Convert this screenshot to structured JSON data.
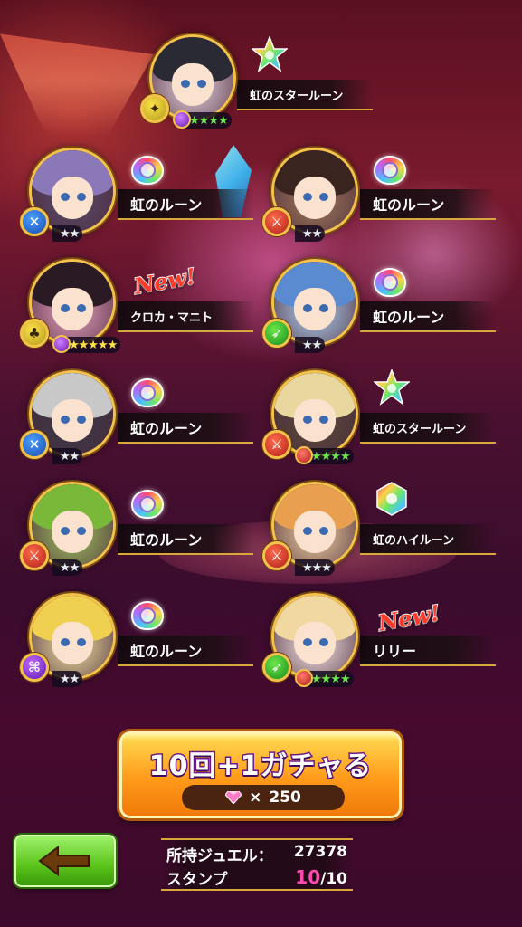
{
  "results": [
    {
      "id": "r1",
      "name": "虹のスタールーン",
      "type": "star",
      "weapon": "yellow",
      "weapon_glyph": "✦",
      "stars": "★★★★",
      "star_color": "green",
      "gem": "purple",
      "new": "",
      "colors": {
        "hair": "#2a2a34",
        "bg": "#ead4e0"
      }
    },
    {
      "id": "r2",
      "name": "虹のルーン",
      "type": "rune",
      "weapon": "blue",
      "weapon_glyph": "✕",
      "stars": "★★",
      "star_color": "white",
      "gem": "",
      "new": "",
      "colors": {
        "hair": "#8a78b8",
        "bg": "#5a4a6a"
      }
    },
    {
      "id": "r3",
      "name": "虹のルーン",
      "type": "rune",
      "weapon": "red",
      "weapon_glyph": "⚔",
      "stars": "★★",
      "star_color": "white",
      "gem": "",
      "new": "",
      "colors": {
        "hair": "#3a2420",
        "bg": "#a07a5a"
      }
    },
    {
      "id": "r4",
      "name": "クロカ・マニト",
      "type": "none",
      "weapon": "yellow",
      "weapon_glyph": "♣",
      "stars": "★★★★★",
      "star_color": "yellow",
      "gem": "purple",
      "new": "New!",
      "colors": {
        "hair": "#2a1a24",
        "bg": "#e8a0c0"
      }
    },
    {
      "id": "r5",
      "name": "虹のルーン",
      "type": "rune",
      "weapon": "green",
      "weapon_glyph": "➶",
      "stars": "★★",
      "star_color": "white",
      "gem": "",
      "new": "",
      "colors": {
        "hair": "#5a8ad0",
        "bg": "#b0d0f0"
      }
    },
    {
      "id": "r6",
      "name": "虹のルーン",
      "type": "rune",
      "weapon": "blue",
      "weapon_glyph": "✕",
      "stars": "★★",
      "star_color": "white",
      "gem": "",
      "new": "",
      "colors": {
        "hair": "#c8c8c8",
        "bg": "#3a3a48"
      }
    },
    {
      "id": "r7",
      "name": "虹のスタールーン",
      "type": "star",
      "weapon": "red",
      "weapon_glyph": "⚔",
      "stars": "★★★★",
      "star_color": "green",
      "gem": "red",
      "new": "",
      "colors": {
        "hair": "#e8d8a0",
        "bg": "#5a4a3a"
      }
    },
    {
      "id": "r8",
      "name": "虹のルーン",
      "type": "rune",
      "weapon": "red",
      "weapon_glyph": "⚔",
      "stars": "★★",
      "star_color": "white",
      "gem": "",
      "new": "",
      "colors": {
        "hair": "#7ab83a",
        "bg": "#a0c060"
      }
    },
    {
      "id": "r9",
      "name": "虹のハイルーン",
      "type": "hex",
      "weapon": "red",
      "weapon_glyph": "⚔",
      "stars": "★★★",
      "star_color": "white",
      "gem": "",
      "new": "",
      "colors": {
        "hair": "#e8a050",
        "bg": "#f0d0a0"
      }
    },
    {
      "id": "r10",
      "name": "虹のルーン",
      "type": "rune",
      "weapon": "purple",
      "weapon_glyph": "⌘",
      "stars": "★★",
      "star_color": "white",
      "gem": "",
      "new": "",
      "colors": {
        "hair": "#f0d050",
        "bg": "#f0e0a0"
      }
    },
    {
      "id": "r11",
      "name": "リリー",
      "type": "none",
      "weapon": "green",
      "weapon_glyph": "➶",
      "stars": "★★★★",
      "star_color": "green",
      "gem": "red",
      "new": "New!",
      "colors": {
        "hair": "#f0d8a0",
        "bg": "#f8e8e8"
      }
    }
  ],
  "gacha_button": {
    "title": "10回+1ガチャる",
    "cost_prefix": "×",
    "cost": "250"
  },
  "stats": {
    "jewel_label": "所持ジュエル：",
    "jewel_value": "27378",
    "stamp_label": "スタンプ",
    "stamp_current": "10",
    "stamp_total": "/10"
  },
  "back_button": {
    "icon": "back-arrow-icon"
  },
  "colors": {
    "accent_gold": "#d8a83a",
    "button_orange": "#ff9a1a",
    "button_green": "#5ac41a",
    "stamp_pink": "#ff4ab0"
  }
}
